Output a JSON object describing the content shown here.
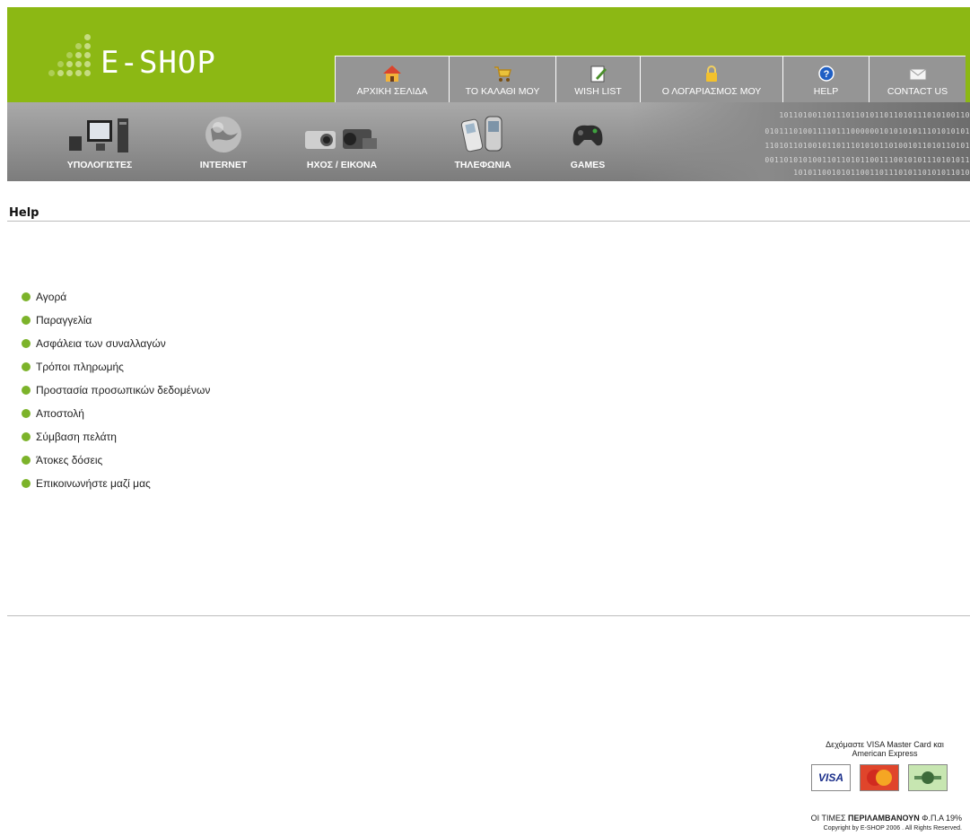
{
  "header": {
    "logo_text": "E-SHOP",
    "nav": [
      {
        "label": "ΑΡΧΙΚΗ ΣΕΛΙΔΑ",
        "icon": "home-icon"
      },
      {
        "label": "ΤΟ ΚΑΛΑΘΙ ΜΟΥ",
        "icon": "cart-icon"
      },
      {
        "label": "WISH LIST",
        "icon": "pencil-note-icon"
      },
      {
        "label": "Ο ΛΟΓΑΡΙΑΣΜΟΣ ΜΟΥ",
        "icon": "lock-icon"
      },
      {
        "label": "HELP",
        "icon": "help-icon"
      },
      {
        "label": "CONTACT US",
        "icon": "envelope-icon"
      }
    ]
  },
  "categories": [
    {
      "label": "ΥΠΟΛΟΓΙΣΤΕΣ",
      "icon": "computer-icon"
    },
    {
      "label": "INTERNET",
      "icon": "globe-icon"
    },
    {
      "label": "ΗΧΟΣ / ΕΙΚΟΝΑ",
      "icon": "camera-icon"
    },
    {
      "label": "ΤΗΛΕΦΩΝΙΑ",
      "icon": "phone-icon"
    },
    {
      "label": "GAMES",
      "icon": "gamepad-icon"
    }
  ],
  "page": {
    "title": "Help",
    "items": [
      "Αγορά",
      "Παραγγελία",
      "Ασφάλεια των συναλλαγών",
      "Τρόποι πληρωμής",
      "Προστασία προσωπικών δεδομένων",
      "Αποστολή",
      "Σύμβαση πελάτη",
      "Άτοκες δόσεις",
      "Επικοινωνήστε μαζί μας"
    ]
  },
  "footer": {
    "payment_line1": "Δεχόμαστε VISA Master Card και",
    "payment_line2": "American Express",
    "cards": [
      "VISA",
      "MasterCard",
      "American Express"
    ],
    "prices_prefix": "ΟΙ ΤΙΜΕΣ ",
    "prices_bold": "ΠΕΡΙΛΑΜΒΑΝΟΥΝ",
    "prices_suffix": " Φ.Π.Α 19%",
    "copyright": "Copyright by E-SHOP  2006 . All Rights Reserved."
  },
  "colors": {
    "header_green": "#8cb814",
    "bullet_green": "#7cb32a",
    "nav_gray": "#959595"
  }
}
